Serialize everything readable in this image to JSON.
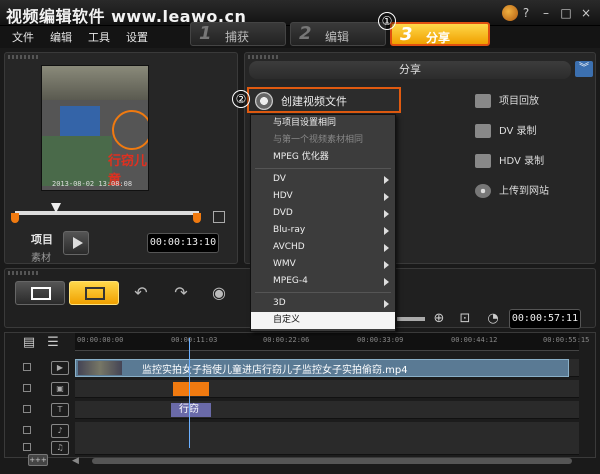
{
  "app": {
    "title": "视频编辑软件 www.leawo.cn"
  },
  "menu": {
    "items": [
      "文件",
      "编辑",
      "工具",
      "设置"
    ]
  },
  "steps": [
    {
      "num": "1",
      "label": "捕获"
    },
    {
      "num": "2",
      "label": "编辑"
    },
    {
      "num": "3",
      "label": "分享"
    }
  ],
  "annotations": {
    "one": "①",
    "two": "②"
  },
  "preview": {
    "caption": "行窃儿童",
    "stamp": "2013-08-02 13:08:08",
    "mode_project": "项目",
    "mode_clip": "素材",
    "timecode": "00:00:13:10"
  },
  "share": {
    "header": "分享",
    "create_video": "创建视频文件",
    "options": [
      "项目回放",
      "DV 录制",
      "HDV 录制",
      "上传到网站"
    ]
  },
  "dropdown": {
    "items": [
      {
        "label": "与项目设置相同",
        "disabled": false,
        "sub": false
      },
      {
        "label": "与第一个视频素材相同",
        "disabled": true,
        "sub": false
      },
      {
        "label": "MPEG 优化器",
        "disabled": false,
        "sub": false
      },
      {
        "label": "DV",
        "disabled": false,
        "sub": true
      },
      {
        "label": "HDV",
        "disabled": false,
        "sub": true
      },
      {
        "label": "DVD",
        "disabled": false,
        "sub": true
      },
      {
        "label": "Blu-ray",
        "disabled": false,
        "sub": true
      },
      {
        "label": "AVCHD",
        "disabled": false,
        "sub": true
      },
      {
        "label": "WMV",
        "disabled": false,
        "sub": true
      },
      {
        "label": "MPEG-4",
        "disabled": false,
        "sub": true
      },
      {
        "label": "3D",
        "disabled": false,
        "sub": true
      },
      {
        "label": "自定义",
        "disabled": false,
        "sub": false
      }
    ]
  },
  "toolbar": {
    "duration": "00:00:57:11"
  },
  "timeline": {
    "ticks": [
      "00:00:00:00",
      "00:00:11:03",
      "00:00:22:06",
      "00:00:33:09",
      "00:00:44:12",
      "00:00:55:15"
    ],
    "video_clip_label": "监控实拍女子指使儿童进店行窃儿子监控女子实拍偷窃.mp4",
    "title_clip_label": "行窃"
  },
  "colors": {
    "accent": "#f0a000",
    "highlight_border": "#e05a10",
    "playhead": "#6cb0ff"
  }
}
